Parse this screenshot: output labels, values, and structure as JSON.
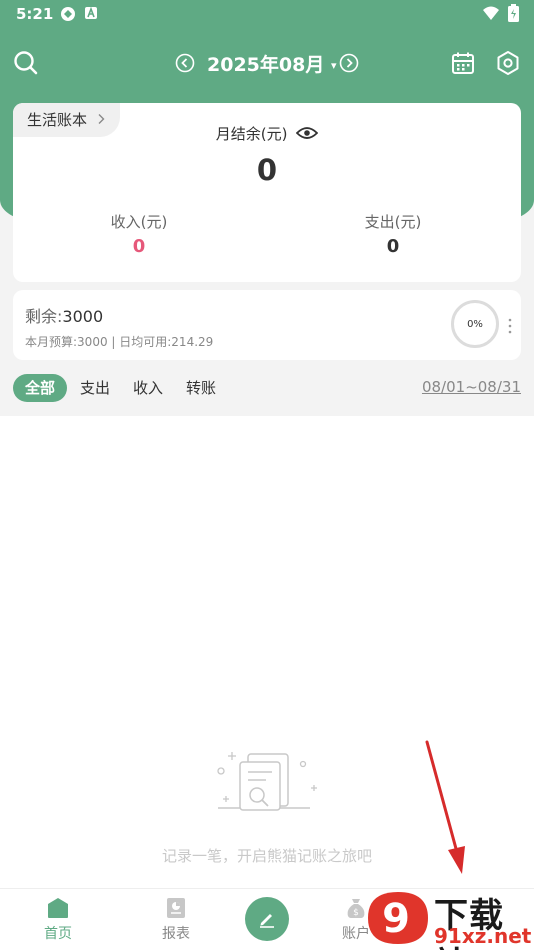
{
  "status_bar": {
    "time": "5:21"
  },
  "header": {
    "month": "2025年08月",
    "month_caret": "▾"
  },
  "account_card": {
    "book_name": "生活账本",
    "balance_label": "月结余(元)",
    "balance_value": "0",
    "income_label": "收入(元)",
    "income_value": "0",
    "expense_label": "支出(元)",
    "expense_value": "0"
  },
  "budget": {
    "remain_label": "剩余:",
    "remain_value": "3000",
    "sub_text": "本月预算:3000 | 日均可用:214.29",
    "progress_text": "0%",
    "progress": 0
  },
  "filters": {
    "tabs": [
      "全部",
      "支出",
      "收入",
      "转账"
    ],
    "active": 0,
    "date_range": "08/01~08/31"
  },
  "empty_state": {
    "text": "记录一笔，开启熊猫记账之旅吧"
  },
  "tabbar": {
    "home": "首页",
    "report": "报表",
    "account": "账户"
  },
  "watermark": {
    "line1": "下载站",
    "line2": "91xz.net",
    "badge": "9"
  },
  "colors": {
    "primary": "#5faa84",
    "income": "#e6587a",
    "annotation_arrow": "#d62b2b"
  }
}
